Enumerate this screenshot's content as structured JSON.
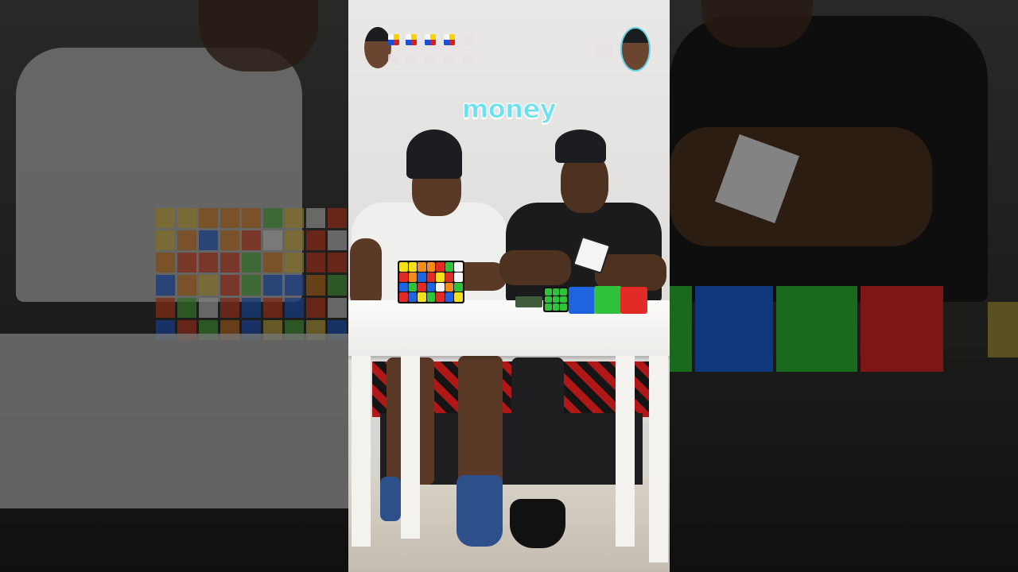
{
  "video": {
    "caption": "money",
    "scoreboard": {
      "left_player_icon": "player-avatar-beanie",
      "left_cubes_won": 4,
      "left_cubes_total": 5,
      "right_player_icon": "player-avatar-cap",
      "right_cubes_won": 0,
      "right_cubes_total": 1
    }
  },
  "colors": {
    "caption_text": "#6ee0f0",
    "caption_outline": "#ffffff",
    "cube_green": "#2fc23a",
    "cube_blue": "#1e63e0",
    "cube_red": "#e22a26",
    "cube_yellow": "#f3df1a",
    "cube_orange": "#f58c1a",
    "cube_white": "#f5f5f5"
  }
}
